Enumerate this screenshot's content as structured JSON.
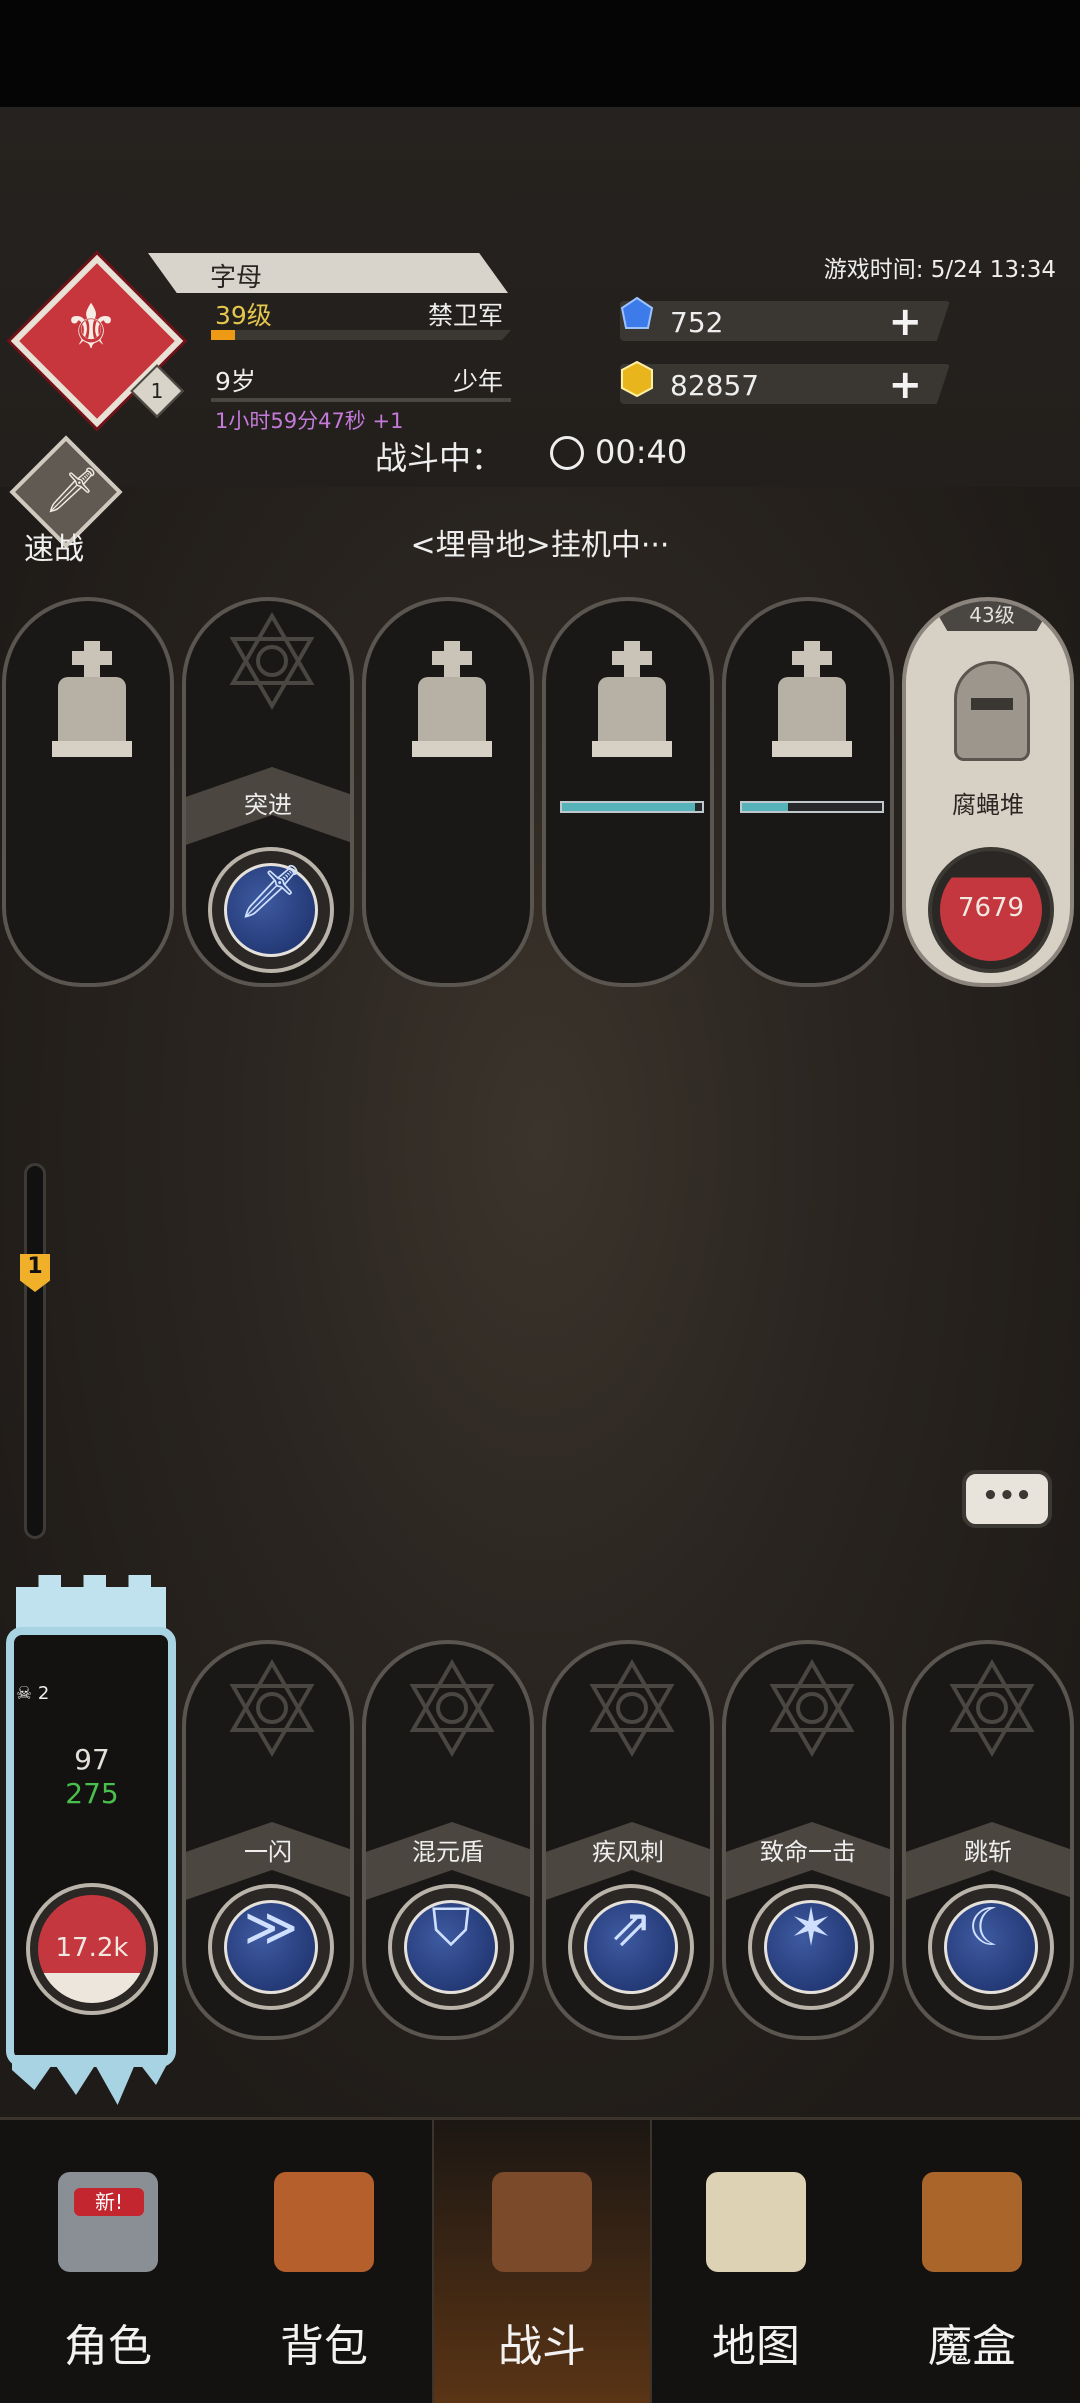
{
  "player": {
    "name": "字母",
    "level": "39级",
    "title": "禁卫军",
    "age": "9岁",
    "stage": "少年",
    "age_timer": "1小时59分47秒 +1",
    "rank_badge": "1",
    "hp": "97",
    "mp": "275",
    "health_orb": "17.2k",
    "kill_count": "2",
    "xp_fraction": 0.08
  },
  "hud": {
    "game_time": "游戏时间: 5/24 13:34",
    "diamonds": "752",
    "gold": "82857",
    "combat_label": "战斗中：",
    "combat_time": "00:40",
    "quick_battle": "速战",
    "zone_status": "<埋骨地>挂机中···"
  },
  "enemies": [
    {
      "type": "tomb"
    },
    {
      "type": "skill",
      "label": "突进",
      "icon": "sword-icon"
    },
    {
      "type": "tomb"
    },
    {
      "type": "tomb",
      "hp_fraction": 0.95
    },
    {
      "type": "tomb",
      "hp_fraction": 0.33
    },
    {
      "type": "boss",
      "level": "43级",
      "name": "腐蝇堆",
      "hp": "7679",
      "icon": "helmet-icon"
    }
  ],
  "progress_marker": "1",
  "chat_label": "•••",
  "skills": [
    {
      "label": "一闪",
      "icon": "flash-icon"
    },
    {
      "label": "混元盾",
      "icon": "shield-icon"
    },
    {
      "label": "疾风刺",
      "icon": "wind-stab-icon"
    },
    {
      "label": "致命一击",
      "icon": "critical-strike-icon"
    },
    {
      "label": "跳斩",
      "icon": "leap-slash-icon"
    }
  ],
  "nav": [
    {
      "label": "角色",
      "badge": "新!"
    },
    {
      "label": "背包"
    },
    {
      "label": "战斗",
      "active": true
    },
    {
      "label": "地图"
    },
    {
      "label": "魔盒"
    }
  ],
  "colors": {
    "accent_red": "#c7353d",
    "gold_text": "#e5c64c",
    "xp_orange": "#ef9a14",
    "hp_bar": "#56b3b9",
    "skill_blue": "#3e5aa0"
  }
}
